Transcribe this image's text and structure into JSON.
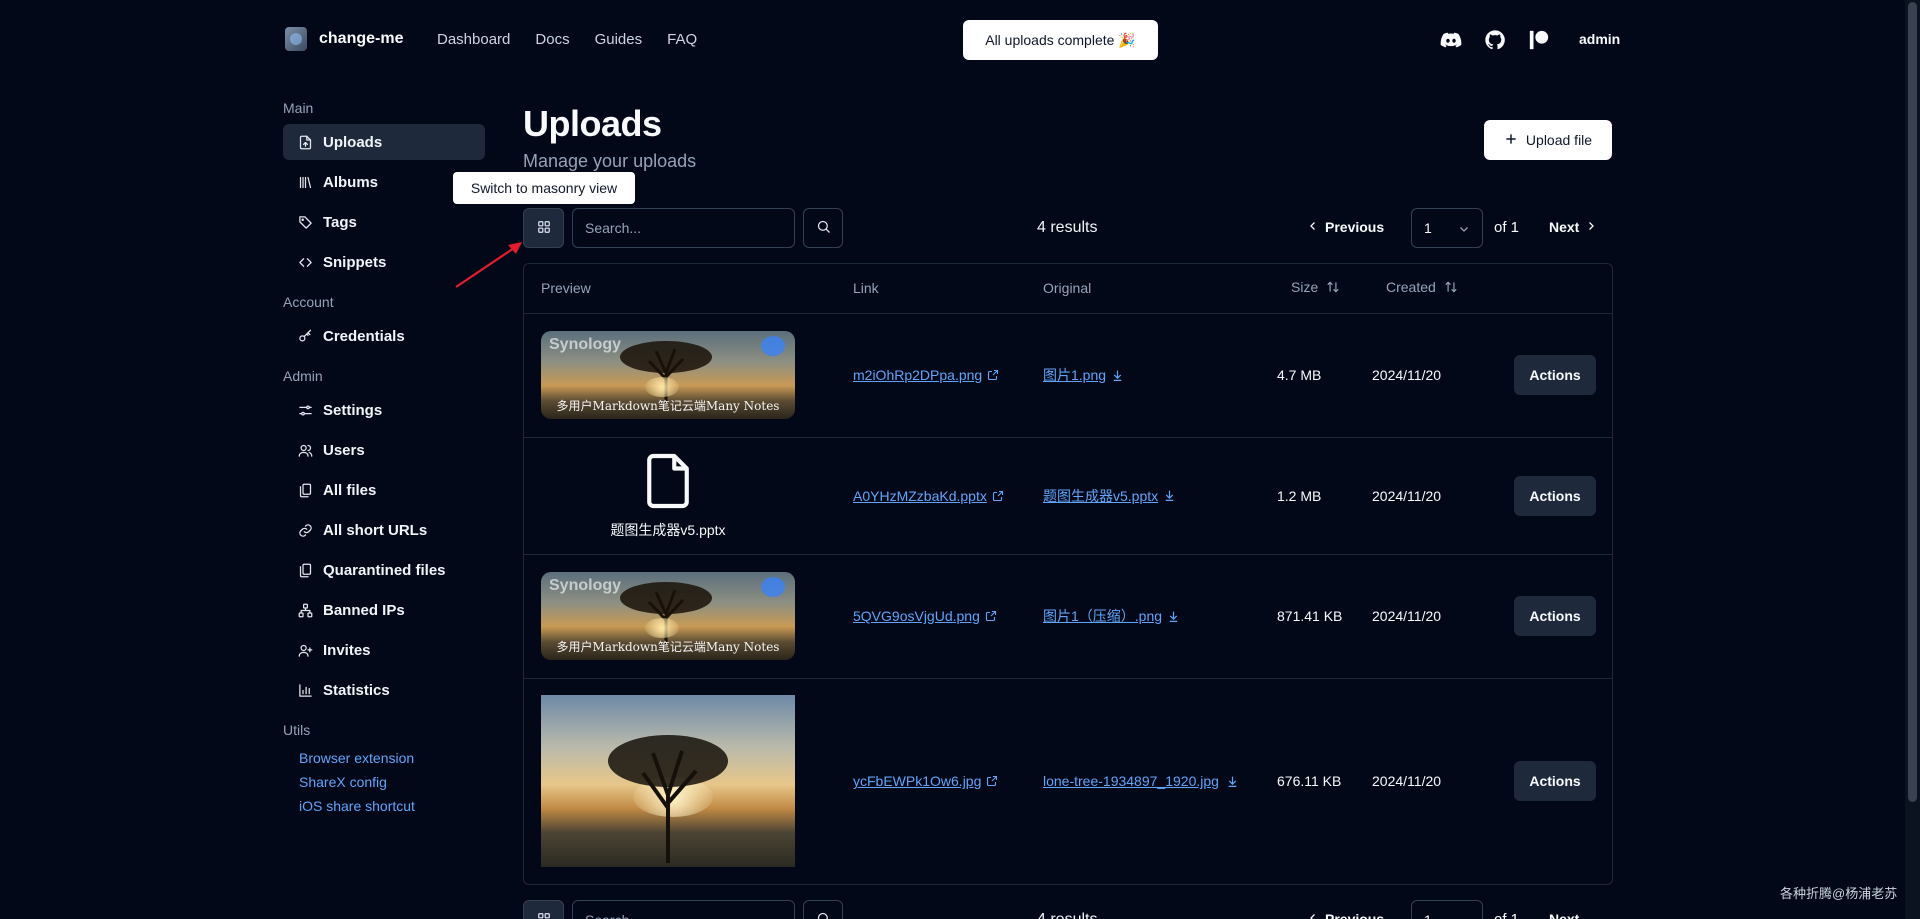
{
  "topnav": {
    "brand": "change-me",
    "links": [
      "Dashboard",
      "Docs",
      "Guides",
      "FAQ"
    ],
    "toast": "All uploads complete 🎉",
    "icons": [
      "discord-icon",
      "github-icon",
      "patreon-icon"
    ],
    "user": "admin"
  },
  "sidebar": {
    "sections": {
      "main": "Main",
      "account": "Account",
      "admin": "Admin",
      "utils": "Utils"
    },
    "main_items": [
      "Uploads",
      "Albums",
      "Tags",
      "Snippets"
    ],
    "account_items": [
      "Credentials"
    ],
    "admin_items": [
      "Settings",
      "Users",
      "All files",
      "All short URLs",
      "Quarantined files",
      "Banned IPs",
      "Invites",
      "Statistics"
    ],
    "utils_items": [
      "Browser extension",
      "ShareX config",
      "iOS share shortcut"
    ]
  },
  "page": {
    "title": "Uploads",
    "subtitle": "Manage your uploads",
    "upload_button": "Upload file",
    "tooltip": "Switch to masonry view"
  },
  "toolbar": {
    "search_placeholder": "Search...",
    "results": "4 results",
    "previous": "Previous",
    "page": "1",
    "of": "of 1",
    "next": "Next"
  },
  "table": {
    "headers": [
      "Preview",
      "Link",
      "Original",
      "Size",
      "Created"
    ],
    "rows": [
      {
        "link": "m2iOhRp2DPpa.png",
        "original": "图片1.png",
        "size": "4.7 MB",
        "created": "2024/11/20",
        "action": "Actions",
        "preview_type": "image-synology"
      },
      {
        "link": "A0YHzMZzbaKd.pptx",
        "original": "题图生成器v5.pptx",
        "size": "1.2 MB",
        "created": "2024/11/20",
        "action": "Actions",
        "preview_type": "file",
        "file_label": "题图生成器v5.pptx"
      },
      {
        "link": "5QVG9osVjgUd.png",
        "original": "图片1（压缩）.png",
        "size": "871.41 KB",
        "created": "2024/11/20",
        "action": "Actions",
        "preview_type": "image-synology"
      },
      {
        "link": "ycFbEWPk1Ow6.jpg",
        "original": "lone-tree-1934897_1920.jpg",
        "size": "676.11 KB",
        "created": "2024/11/20",
        "action": "Actions",
        "preview_type": "image-photo"
      }
    ],
    "thumb_text": {
      "brand": "Synology",
      "caption": "多用户Markdown笔记云端Many Notes"
    }
  },
  "watermark": "各种折腾@杨浦老苏",
  "colors": {
    "background": "#020817",
    "accent_link": "#60a5fa",
    "muted": "#94a3b8",
    "button_dark": "#1e293b"
  }
}
